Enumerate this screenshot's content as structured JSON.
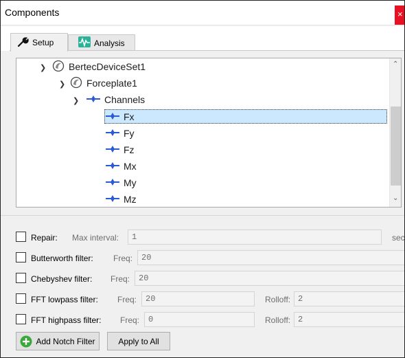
{
  "window": {
    "title": "Components",
    "close_glyph": "×"
  },
  "tabs": [
    {
      "label": "Setup",
      "icon": "wrench-icon",
      "active": true
    },
    {
      "label": "Analysis",
      "icon": "waveform-icon",
      "active": false
    }
  ],
  "tree": {
    "items": [
      {
        "label": "BertecDeviceSet1",
        "icon": "device-set-icon",
        "expanded": true
      },
      {
        "label": "Forceplate1",
        "icon": "forceplate-icon",
        "expanded": true
      },
      {
        "label": "Channels",
        "icon": "channel-icon",
        "expanded": true
      },
      {
        "label": "Fx",
        "icon": "channel-icon",
        "selected": true
      },
      {
        "label": "Fy",
        "icon": "channel-icon"
      },
      {
        "label": "Fz",
        "icon": "channel-icon"
      },
      {
        "label": "Mx",
        "icon": "channel-icon"
      },
      {
        "label": "My",
        "icon": "channel-icon"
      },
      {
        "label": "Mz",
        "icon": "channel-icon"
      }
    ]
  },
  "filters": {
    "repair": {
      "label": "Repair:",
      "field_label": "Max interval:",
      "value": "1",
      "unit": "sec",
      "checked": false
    },
    "butterworth": {
      "label": "Butterworth filter:",
      "freq_label": "Freq:",
      "freq": "20",
      "checked": false
    },
    "chebyshev": {
      "label": "Chebyshev filter:",
      "freq_label": "Freq:",
      "freq": "20",
      "checked": false
    },
    "fft_lowpass": {
      "label": "FFT lowpass filter:",
      "freq_label": "Freq:",
      "freq": "20",
      "rolloff_label": "Rolloff:",
      "rolloff": "2",
      "checked": false
    },
    "fft_highpass": {
      "label": "FFT highpass filter:",
      "freq_label": "Freq:",
      "freq": "0",
      "rolloff_label": "Rolloff:",
      "rolloff": "2",
      "checked": false
    }
  },
  "buttons": {
    "add_notch": "Add Notch Filter",
    "apply_all": "Apply to All"
  },
  "colors": {
    "selection": "#cce8ff",
    "close": "#e81123",
    "add_icon": "#3aa83a",
    "channel_icon": "#2a5bd7"
  }
}
